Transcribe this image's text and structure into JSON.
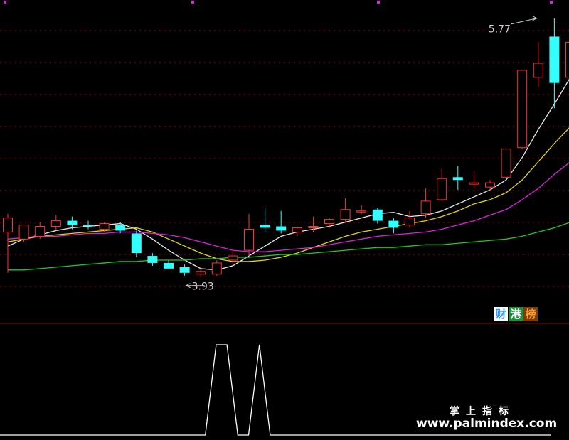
{
  "chart_data": [
    {
      "type": "candlestick",
      "ylim": [
        3.6,
        5.9
      ],
      "annotations": [
        {
          "text": "5.77",
          "value": 5.77,
          "index": 33
        },
        {
          "text": "3.93",
          "value": 3.93,
          "index": 11
        }
      ],
      "candles": [
        {
          "o": 4.25,
          "h": 4.38,
          "l": 3.96,
          "c": 4.35
        },
        {
          "o": 4.2,
          "h": 4.3,
          "l": 4.18,
          "c": 4.3
        },
        {
          "o": 4.22,
          "h": 4.32,
          "l": 4.2,
          "c": 4.29
        },
        {
          "o": 4.29,
          "h": 4.37,
          "l": 4.26,
          "c": 4.33
        },
        {
          "o": 4.33,
          "h": 4.36,
          "l": 4.27,
          "c": 4.3
        },
        {
          "o": 4.3,
          "h": 4.33,
          "l": 4.27,
          "c": 4.29
        },
        {
          "o": 4.27,
          "h": 4.32,
          "l": 4.25,
          "c": 4.31
        },
        {
          "o": 4.3,
          "h": 4.32,
          "l": 4.24,
          "c": 4.26
        },
        {
          "o": 4.24,
          "h": 4.26,
          "l": 4.07,
          "c": 4.1
        },
        {
          "o": 4.08,
          "h": 4.1,
          "l": 4.01,
          "c": 4.03
        },
        {
          "o": 4.03,
          "h": 4.05,
          "l": 3.99,
          "c": 3.99
        },
        {
          "o": 4.0,
          "h": 4.02,
          "l": 3.94,
          "c": 3.96
        },
        {
          "o": 3.95,
          "h": 3.99,
          "l": 3.93,
          "c": 3.97
        },
        {
          "o": 3.95,
          "h": 4.05,
          "l": 3.94,
          "c": 4.03
        },
        {
          "o": 4.05,
          "h": 4.12,
          "l": 4.02,
          "c": 4.08
        },
        {
          "o": 4.12,
          "h": 4.38,
          "l": 4.08,
          "c": 4.27
        },
        {
          "o": 4.3,
          "h": 4.42,
          "l": 4.25,
          "c": 4.28
        },
        {
          "o": 4.29,
          "h": 4.4,
          "l": 4.24,
          "c": 4.26
        },
        {
          "o": 4.25,
          "h": 4.29,
          "l": 4.22,
          "c": 4.28
        },
        {
          "o": 4.28,
          "h": 4.36,
          "l": 4.25,
          "c": 4.29
        },
        {
          "o": 4.31,
          "h": 4.35,
          "l": 4.28,
          "c": 4.34
        },
        {
          "o": 4.34,
          "h": 4.49,
          "l": 4.32,
          "c": 4.41
        },
        {
          "o": 4.4,
          "h": 4.44,
          "l": 4.38,
          "c": 4.4
        },
        {
          "o": 4.41,
          "h": 4.42,
          "l": 4.31,
          "c": 4.33
        },
        {
          "o": 4.33,
          "h": 4.35,
          "l": 4.24,
          "c": 4.28
        },
        {
          "o": 4.3,
          "h": 4.4,
          "l": 4.28,
          "c": 4.35
        },
        {
          "o": 4.38,
          "h": 4.56,
          "l": 4.35,
          "c": 4.47
        },
        {
          "o": 4.48,
          "h": 4.7,
          "l": 4.47,
          "c": 4.63
        },
        {
          "o": 4.64,
          "h": 4.72,
          "l": 4.55,
          "c": 4.62
        },
        {
          "o": 4.59,
          "h": 4.68,
          "l": 4.56,
          "c": 4.6
        },
        {
          "o": 4.57,
          "h": 4.62,
          "l": 4.54,
          "c": 4.6
        },
        {
          "o": 4.64,
          "h": 4.84,
          "l": 4.63,
          "c": 4.84
        },
        {
          "o": 4.85,
          "h": 5.4,
          "l": 4.84,
          "c": 5.4
        },
        {
          "o": 5.35,
          "h": 5.6,
          "l": 5.28,
          "c": 5.45
        },
        {
          "o": 5.64,
          "h": 5.77,
          "l": 5.13,
          "c": 5.31
        },
        {
          "o": 5.35,
          "h": 5.72,
          "l": 5.27,
          "c": 5.6
        }
      ],
      "ma_lines": [
        {
          "color": "#e6e6e6",
          "values": [
            4.15,
            4.2,
            4.23,
            4.26,
            4.28,
            4.29,
            4.3,
            4.31,
            4.27,
            4.2,
            4.12,
            4.05,
            3.99,
            3.98,
            4.01,
            4.08,
            4.15,
            4.22,
            4.25,
            4.27,
            4.29,
            4.32,
            4.35,
            4.38,
            4.39,
            4.36,
            4.37,
            4.4,
            4.45,
            4.5,
            4.55,
            4.62,
            4.78,
            4.98,
            5.16,
            5.35
          ]
        },
        {
          "color": "#e6d800",
          "values": [
            4.18,
            4.2,
            4.22,
            4.23,
            4.24,
            4.25,
            4.26,
            4.27,
            4.28,
            4.25,
            4.2,
            4.15,
            4.1,
            4.06,
            4.04,
            4.04,
            4.05,
            4.07,
            4.1,
            4.14,
            4.18,
            4.22,
            4.25,
            4.27,
            4.29,
            4.31,
            4.33,
            4.36,
            4.4,
            4.45,
            4.48,
            4.53,
            4.62,
            4.75,
            4.88,
            5.0
          ]
        },
        {
          "color": "#e020e0",
          "values": [
            4.2,
            4.21,
            4.22,
            4.22,
            4.23,
            4.24,
            4.24,
            4.25,
            4.25,
            4.24,
            4.23,
            4.21,
            4.18,
            4.15,
            4.12,
            4.11,
            4.11,
            4.12,
            4.13,
            4.14,
            4.16,
            4.18,
            4.2,
            4.22,
            4.23,
            4.24,
            4.25,
            4.27,
            4.3,
            4.33,
            4.37,
            4.41,
            4.48,
            4.56,
            4.66,
            4.75
          ]
        },
        {
          "color": "#20cc20",
          "values": [
            3.98,
            3.98,
            3.99,
            4.0,
            4.01,
            4.02,
            4.03,
            4.04,
            4.04,
            4.05,
            4.05,
            4.05,
            4.06,
            4.06,
            4.07,
            4.07,
            4.08,
            4.09,
            4.09,
            4.1,
            4.11,
            4.12,
            4.13,
            4.14,
            4.14,
            4.15,
            4.16,
            4.16,
            4.17,
            4.18,
            4.19,
            4.2,
            4.22,
            4.25,
            4.28,
            4.32
          ]
        }
      ]
    },
    {
      "type": "line",
      "ylim": [
        0,
        1
      ],
      "series": [
        {
          "color": "#ffffff",
          "values": [
            0,
            0,
            0,
            0,
            0,
            0,
            0,
            0,
            0,
            0,
            0,
            0,
            0,
            0,
            0,
            0,
            0,
            0,
            0,
            0,
            1,
            1,
            0,
            0,
            1,
            0,
            0,
            0,
            0,
            0,
            0,
            0,
            0,
            0,
            0,
            0,
            0,
            0,
            0,
            0,
            0,
            0,
            0,
            0,
            0,
            0,
            0,
            0,
            0,
            0,
            0,
            0
          ]
        }
      ]
    }
  ],
  "badges": [
    {
      "text": "财",
      "color": "#3399ff",
      "bg": "#ffffff"
    },
    {
      "text": "港",
      "color": "#ffffff",
      "bg": "#1f8f3a"
    },
    {
      "text": "榜",
      "color": "#ff9933",
      "bg": "#7a3d00"
    }
  ],
  "watermark": {
    "title": "掌上指标",
    "url": "www.palmindex.com"
  },
  "colors": {
    "up": "#ff3333",
    "down": "#33ffff",
    "grid": "#a00000",
    "marker": "#e020e0"
  }
}
